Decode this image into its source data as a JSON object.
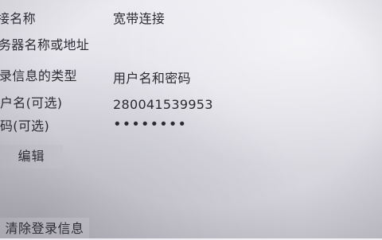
{
  "settings": {
    "rows": [
      {
        "label": "接名称",
        "value": "宽带连接"
      },
      {
        "label": "务器名称或地址",
        "value": ""
      },
      {
        "label": "录信息的类型",
        "value": "用户名和密码"
      },
      {
        "label": "户名(可选)",
        "value": "280041539953"
      },
      {
        "label": "码(可选)",
        "value": "••••••••"
      }
    ],
    "edit_label": "编辑",
    "clear_label": "清除登录信息"
  }
}
